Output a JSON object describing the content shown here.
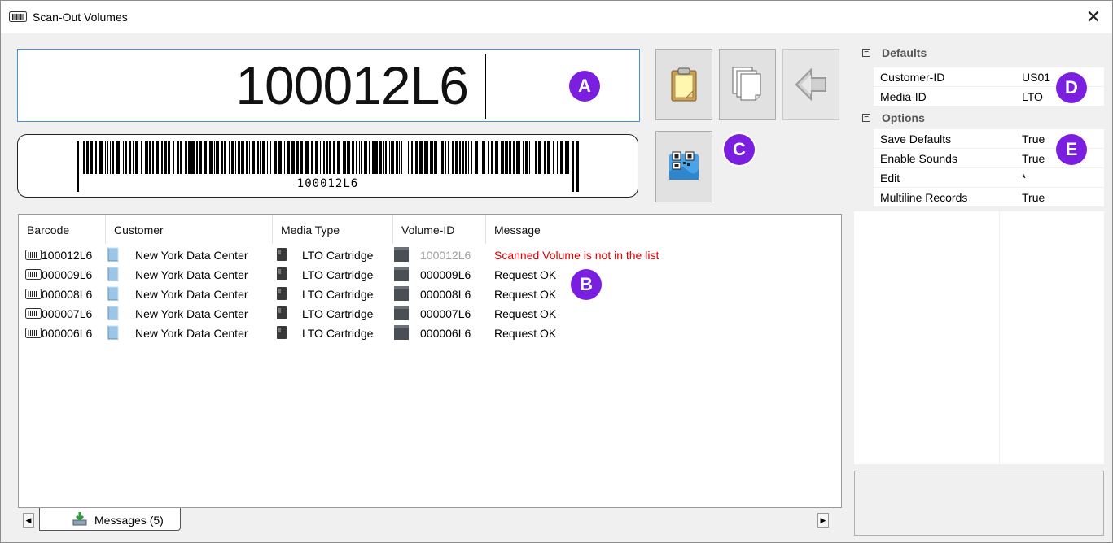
{
  "window": {
    "title": "Scan-Out Volumes",
    "close_glyph": "✕"
  },
  "scan": {
    "value": "100012L6"
  },
  "barcode": {
    "text": "100012L6"
  },
  "badges": {
    "a": "A",
    "b": "B",
    "c": "C",
    "d": "D",
    "e": "E"
  },
  "toolbar": {
    "icons": [
      "clipboard-icon",
      "copy-icon",
      "back-arrow-icon",
      "qr-scan-icon"
    ]
  },
  "list": {
    "columns": [
      "Barcode",
      "Customer",
      "Media Type",
      "Volume-ID",
      "Message"
    ],
    "rows": [
      {
        "barcode": "100012L6",
        "customer": "New York Data Center",
        "media": "LTO Cartridge",
        "volume": "100012L6",
        "message": "Scanned Volume is not in the list",
        "status": "error"
      },
      {
        "barcode": "000009L6",
        "customer": "New York Data Center",
        "media": "LTO Cartridge",
        "volume": "000009L6",
        "message": "Request OK",
        "status": "ok"
      },
      {
        "barcode": "000008L6",
        "customer": "New York Data Center",
        "media": "LTO Cartridge",
        "volume": "000008L6",
        "message": "Request OK",
        "status": "ok"
      },
      {
        "barcode": "000007L6",
        "customer": "New York Data Center",
        "media": "LTO Cartridge",
        "volume": "000007L6",
        "message": "Request OK",
        "status": "ok"
      },
      {
        "barcode": "000006L6",
        "customer": "New York Data Center",
        "media": "LTO Cartridge",
        "volume": "000006L6",
        "message": "Request OK",
        "status": "ok"
      }
    ]
  },
  "tabs": {
    "messages_label": "Messages (5)"
  },
  "properties": {
    "defaults_label": "Defaults",
    "options_label": "Options",
    "defaults": [
      {
        "name": "Customer-ID",
        "value": "US01"
      },
      {
        "name": "Media-ID",
        "value": "LTO"
      }
    ],
    "options": [
      {
        "name": "Save Defaults",
        "value": "True"
      },
      {
        "name": "Enable Sounds",
        "value": "True"
      },
      {
        "name": "Edit",
        "value": "*"
      },
      {
        "name": "Multiline Records",
        "value": "True"
      }
    ]
  },
  "colors": {
    "accent": "#7a1fe0",
    "error": "#e00000",
    "focus_border": "#4a90d9"
  }
}
